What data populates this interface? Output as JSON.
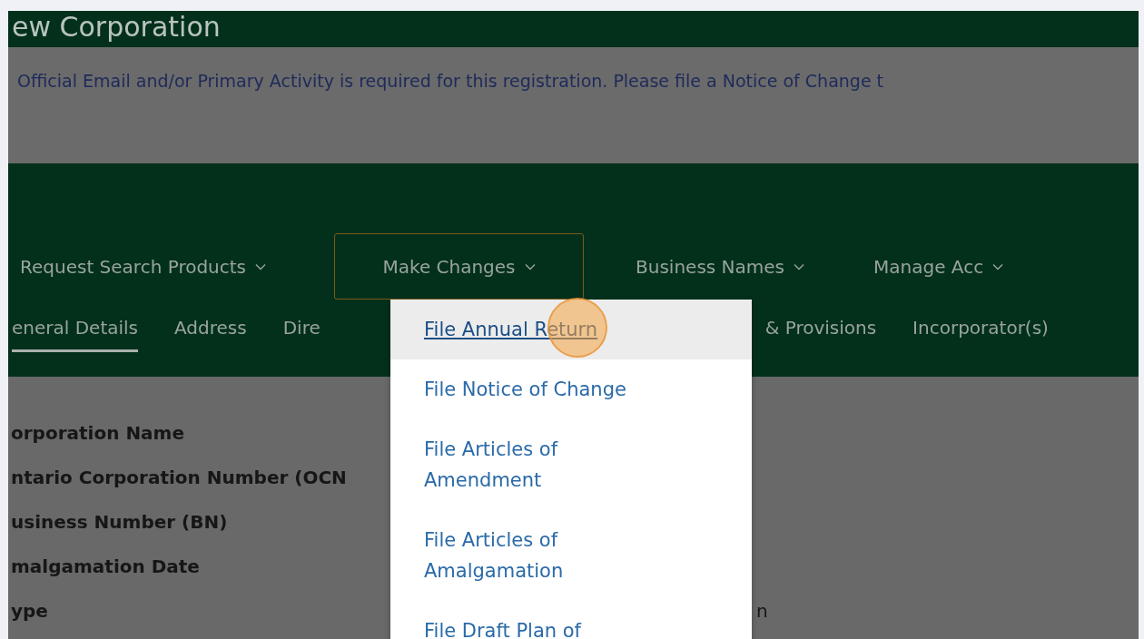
{
  "page_title": "ew Corporation",
  "notice": "Official Email and/or Primary Activity is required for this registration. Please file a Notice of Change t",
  "nav": [
    {
      "label": "Request Search Products",
      "selected": false
    },
    {
      "label": "Make Changes",
      "selected": true
    },
    {
      "label": "Business Names",
      "selected": false
    },
    {
      "label": "Manage Acc",
      "selected": false
    }
  ],
  "tabs": [
    {
      "label": "eneral Details",
      "selected": true
    },
    {
      "label": "Address",
      "selected": false
    },
    {
      "label": "Dire",
      "selected": false
    },
    {
      "label": "& Provisions",
      "selected": false
    },
    {
      "label": "Incorporator(s)",
      "selected": false
    }
  ],
  "details": [
    {
      "label": "orporation Name"
    },
    {
      "label": "ntario Corporation Number (OCN"
    },
    {
      "label": "usiness Number (BN)"
    },
    {
      "label": "malgamation Date"
    },
    {
      "label": "ype",
      "value": "n"
    }
  ],
  "dropdown": [
    {
      "label": "File Annual Return",
      "selected": true
    },
    {
      "label": "File Notice of Change",
      "selected": false
    },
    {
      "label": "File Articles of Amendment",
      "selected": false
    },
    {
      "label": "File Articles of Amalgamation",
      "selected": false
    },
    {
      "label": "File Draft Plan of",
      "selected": false
    }
  ]
}
